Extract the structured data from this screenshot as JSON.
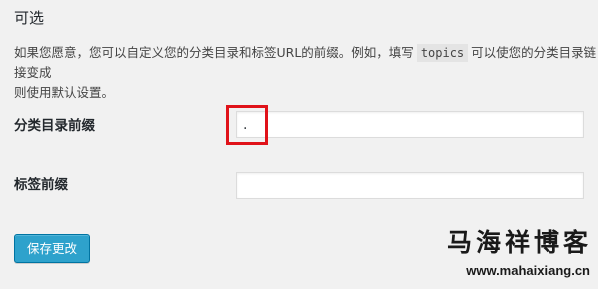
{
  "section": {
    "title": "可选"
  },
  "description": {
    "before_code": "如果您愿意，您可以自定义您的分类目录和标签URL的前缀。例如，填写",
    "code": "topics",
    "after_code": "可以使您的分类目录链接变成",
    "line2": "则使用默认设置。"
  },
  "fields": {
    "category_base": {
      "label": "分类目录前缀",
      "value": "."
    },
    "tag_base": {
      "label": "标签前缀",
      "value": ""
    }
  },
  "actions": {
    "save_label": "保存更改"
  },
  "watermark": {
    "name": "马海祥博客",
    "url": "www.mahaixiang.cn"
  },
  "colors": {
    "highlight": "#e0121a",
    "button": "#2ea2cc"
  }
}
